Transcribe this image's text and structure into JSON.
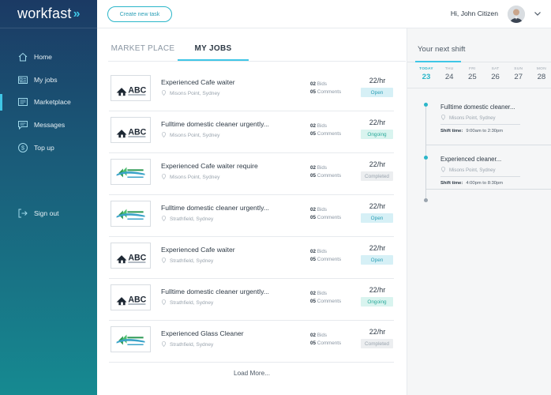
{
  "brand": {
    "name": "workfast",
    "chevron": "»"
  },
  "sidebar": {
    "items": [
      {
        "label": "Home",
        "icon": "home-icon"
      },
      {
        "label": "My jobs",
        "icon": "jobs-card-icon"
      },
      {
        "label": "Marketplace",
        "icon": "marketplace-icon"
      },
      {
        "label": "Messages",
        "icon": "messages-icon"
      },
      {
        "label": "Top up",
        "icon": "dollar-icon"
      }
    ],
    "signout": {
      "label": "Sign out",
      "icon": "sign-out-icon"
    }
  },
  "topbar": {
    "create_label": "Create new task",
    "greeting": "Hi, John Citizen"
  },
  "tabs": {
    "marketplace": "MARKET PLACE",
    "myjobs": "MY JOBS"
  },
  "jobs": [
    {
      "title": "Experienced Cafe waiter",
      "location": "Misons Point, Sydney",
      "bids": "02",
      "bids_label": "Bids",
      "comments": "05",
      "comments_label": "Comments",
      "rate": "22/hr",
      "status": "Open",
      "logo": "ABC"
    },
    {
      "title": "Fulltime domestic cleaner urgently...",
      "location": "Misons Point, Sydney",
      "bids": "02",
      "bids_label": "Bids",
      "comments": "05",
      "comments_label": "Comments",
      "rate": "22/hr",
      "status": "Ongoing",
      "logo": "ABC"
    },
    {
      "title": "Experienced Cafe waiter require",
      "location": "Misons Point, Sydney",
      "bids": "02",
      "bids_label": "Bids",
      "comments": "05",
      "comments_label": "Comments",
      "rate": "22/hr",
      "status": "Completed",
      "logo": "green"
    },
    {
      "title": "Fulltime domestic cleaner urgently...",
      "location": "Strathfield, Sydney",
      "bids": "02",
      "bids_label": "Bids",
      "comments": "05",
      "comments_label": "Comments",
      "rate": "22/hr",
      "status": "Open",
      "logo": "green"
    },
    {
      "title": "Experienced Cafe waiter",
      "location": "Strathfield, Sydney",
      "bids": "02",
      "bids_label": "Bids",
      "comments": "05",
      "comments_label": "Comments",
      "rate": "22/hr",
      "status": "Open",
      "logo": "ABC"
    },
    {
      "title": "Fulltime domestic cleaner urgently...",
      "location": "Strathfield, Sydney",
      "bids": "02",
      "bids_label": "Bids",
      "comments": "05",
      "comments_label": "Comments",
      "rate": "22/hr",
      "status": "Ongoing",
      "logo": "ABC"
    },
    {
      "title": "Experienced Glass Cleaner",
      "location": "Strathfield, Sydney",
      "bids": "02",
      "bids_label": "Bids",
      "comments": "05",
      "comments_label": "Comments",
      "rate": "22/hr",
      "status": "Completed",
      "logo": "green"
    }
  ],
  "load_more": "Load More...",
  "shifts_panel": {
    "title": "Your next shift",
    "days": [
      {
        "name": "TODAY",
        "num": "23",
        "today": true
      },
      {
        "name": "THU",
        "num": "24"
      },
      {
        "name": "FRI",
        "num": "25"
      },
      {
        "name": "SAT",
        "num": "26"
      },
      {
        "name": "SUN",
        "num": "27"
      },
      {
        "name": "MON",
        "num": "28"
      }
    ],
    "shifts": [
      {
        "title": "Fulltime domestic cleaner...",
        "location": "Misons Point, Sydney",
        "time_label": "Shift time:",
        "time": "9:00am to 2:30pm"
      },
      {
        "title": "Experienced cleaner...",
        "location": "Misons Point, Sydney",
        "time_label": "Shift time:",
        "time": "4:00pm to 8:30pm"
      }
    ]
  },
  "colors": {
    "accent": "#3fc6e6",
    "sidebar_top": "#1b3a64",
    "sidebar_bottom": "#168a91"
  }
}
